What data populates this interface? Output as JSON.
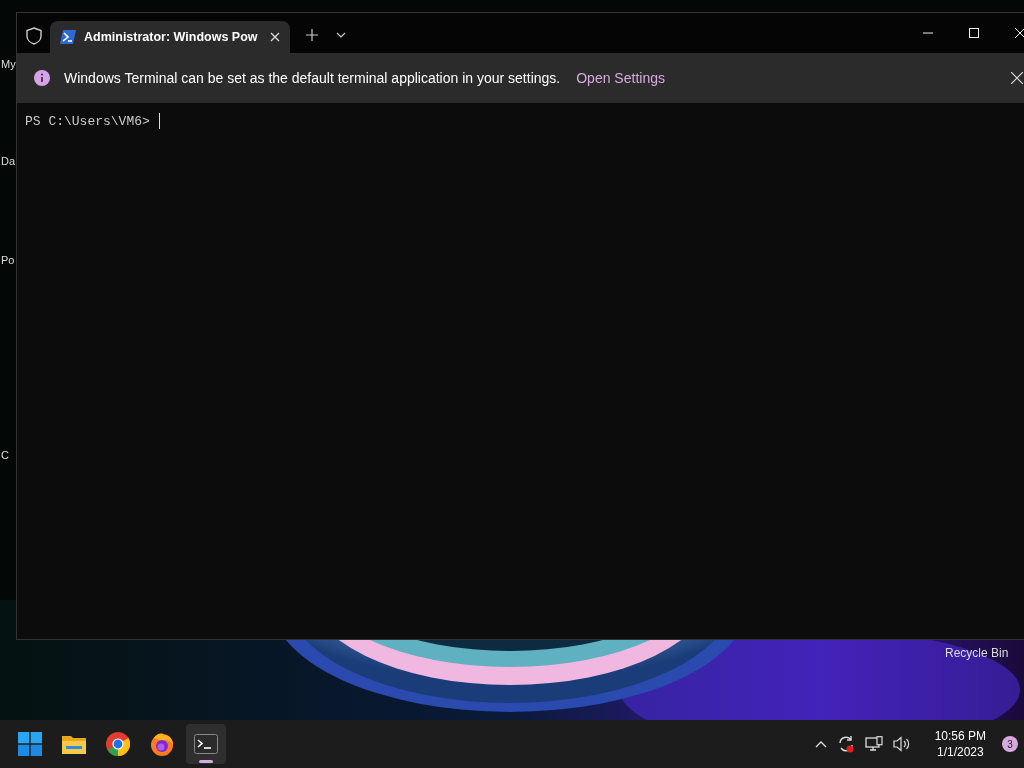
{
  "desktop": {
    "icon_labels": [
      "My",
      "Da",
      "Po",
      "C"
    ],
    "recycle_bin_label": "Recycle Bin"
  },
  "window": {
    "tabs": [
      {
        "title": "Administrator: Windows Pow",
        "selected": true
      }
    ],
    "info_bar": {
      "message": "Windows Terminal can be set as the default terminal application in your settings.",
      "link": "Open Settings"
    },
    "terminal": {
      "prompt": "PS C:\\Users\\VM6>"
    }
  },
  "taskbar": {
    "apps": [
      {
        "kind": "start",
        "selected": false
      },
      {
        "kind": "explorer",
        "selected": false
      },
      {
        "kind": "chrome",
        "selected": false
      },
      {
        "kind": "firefox",
        "selected": false
      },
      {
        "kind": "terminal",
        "selected": true
      }
    ],
    "clock": {
      "time": "10:56 PM",
      "date": "1/1/2023"
    },
    "notification_count": "3"
  }
}
